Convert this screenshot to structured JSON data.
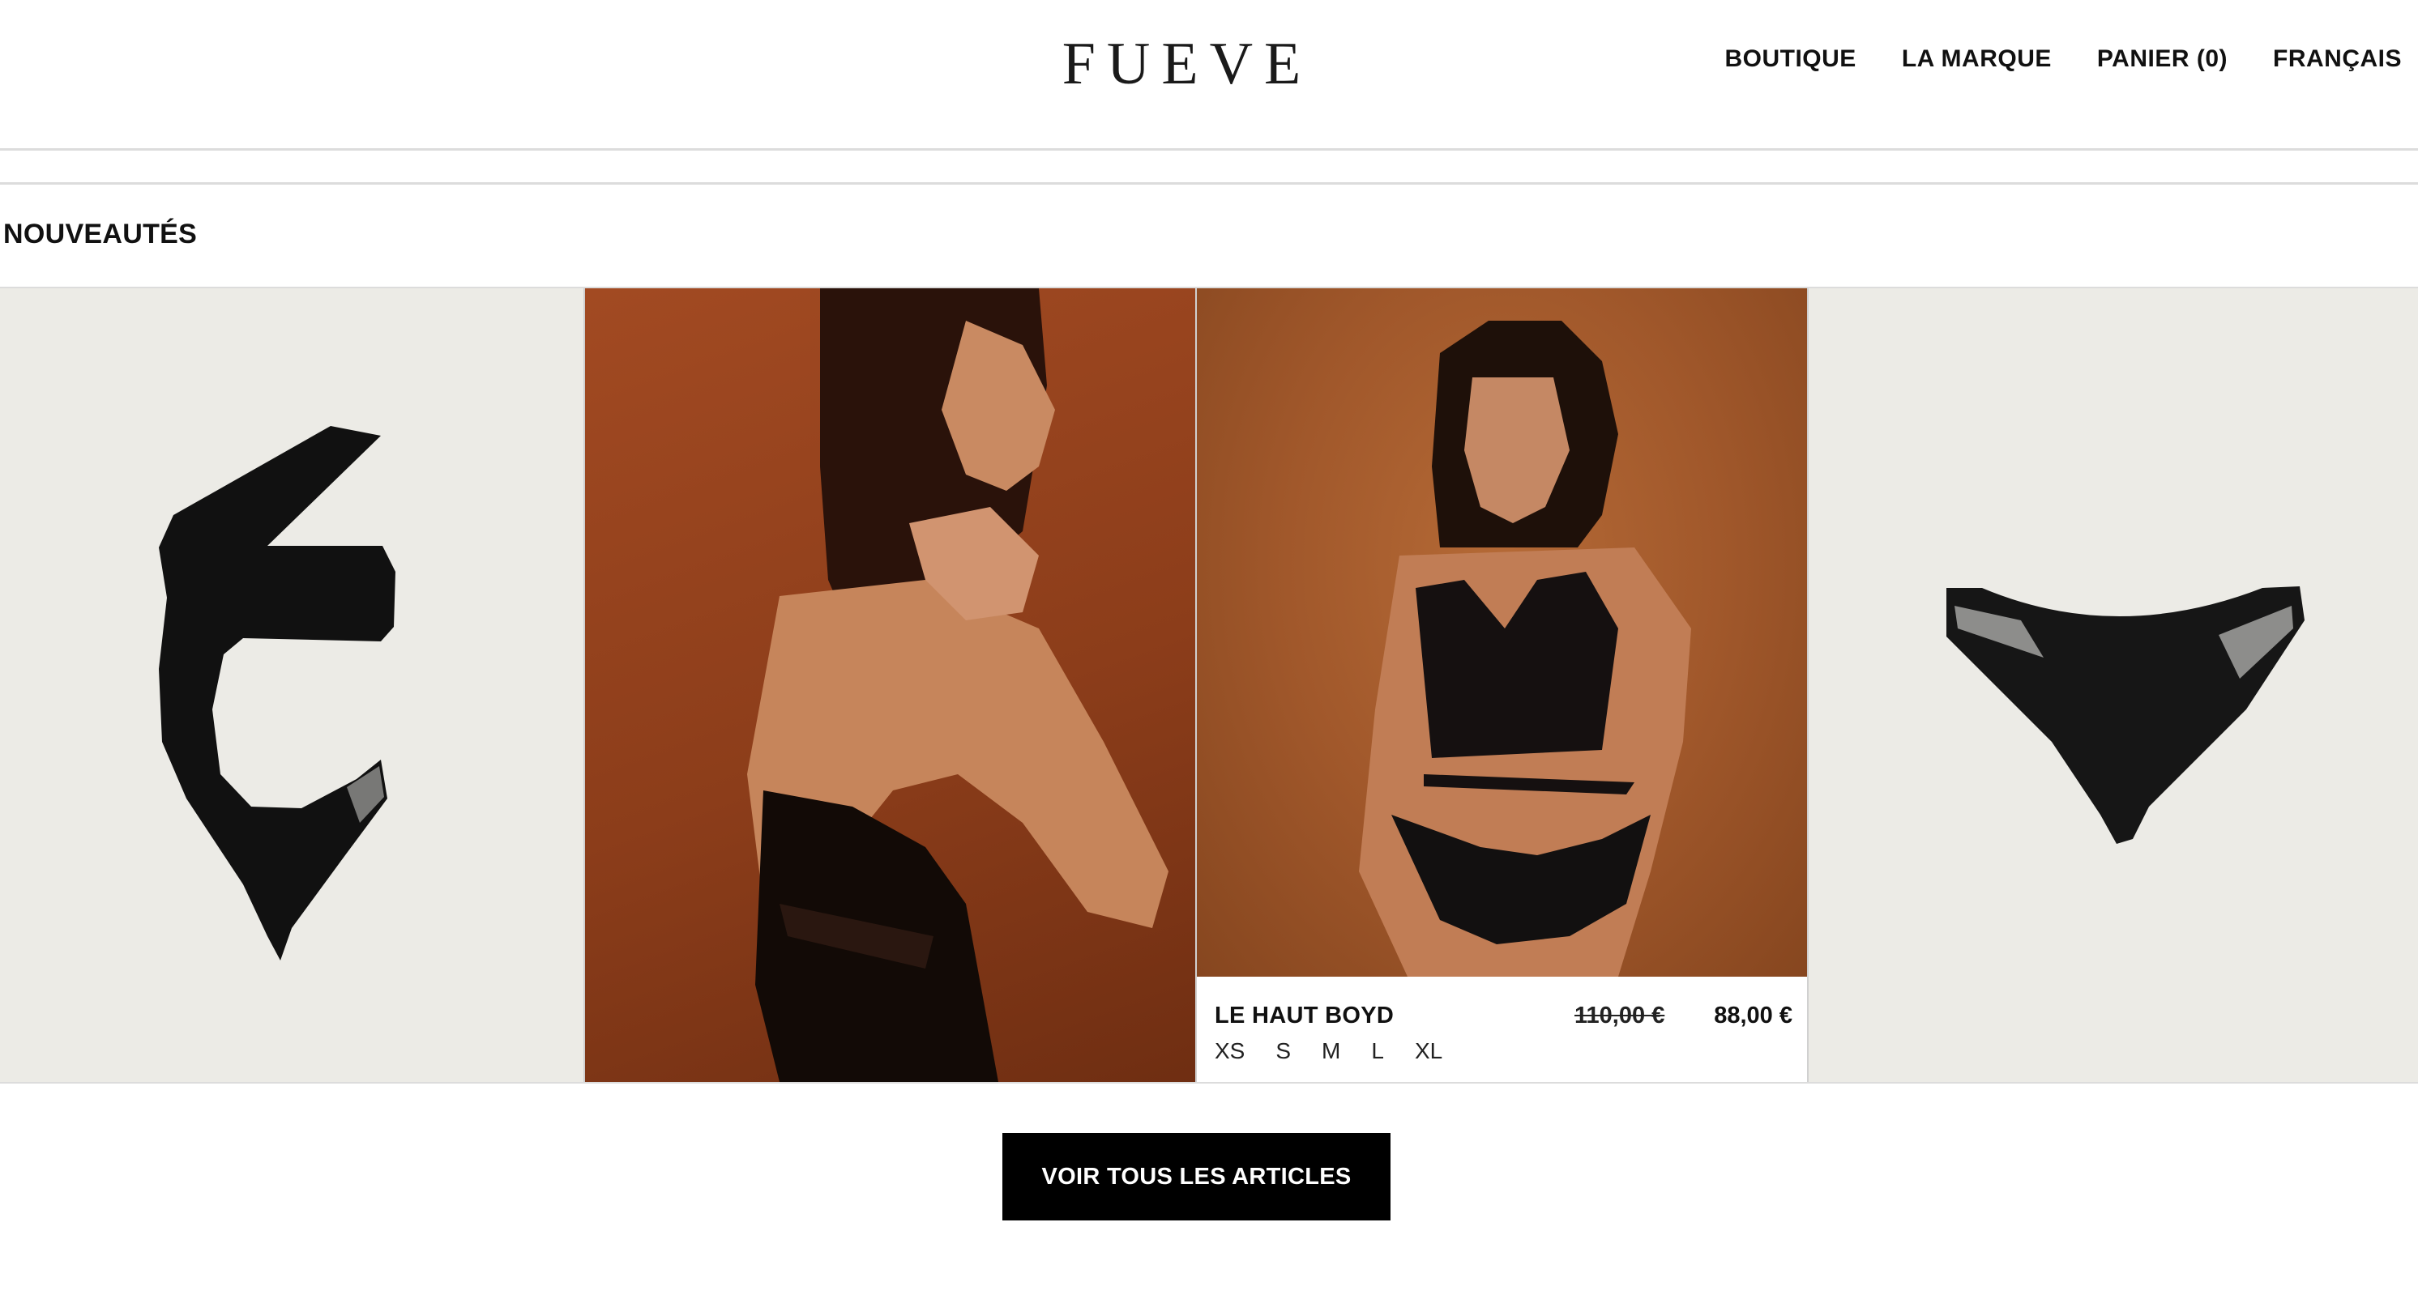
{
  "header": {
    "logo": "FUEVE",
    "nav": [
      "BOUTIQUE",
      "LA MARQUE",
      "PANIER (0)",
      "FRANÇAIS"
    ]
  },
  "section": {
    "title": "NOUVEAUTÉS"
  },
  "products": [
    {
      "image": "black-one-shoulder-swimsuit"
    },
    {
      "image": "model-black-swimsuit-back"
    },
    {
      "image": "model-black-bikini-set",
      "name": "LE HAUT BOYD",
      "price_old": "110,00 €",
      "price_new": "88,00 €",
      "sizes": [
        "XS",
        "S",
        "M",
        "L",
        "XL"
      ]
    },
    {
      "image": "black-bikini-bottom-mesh"
    }
  ],
  "cta": {
    "label": "VOIR TOUS LES ARTICLES"
  },
  "colors": {
    "accent": "#000000",
    "product_bg": "#ecebe6",
    "photo_bg": "#9c4a22"
  }
}
